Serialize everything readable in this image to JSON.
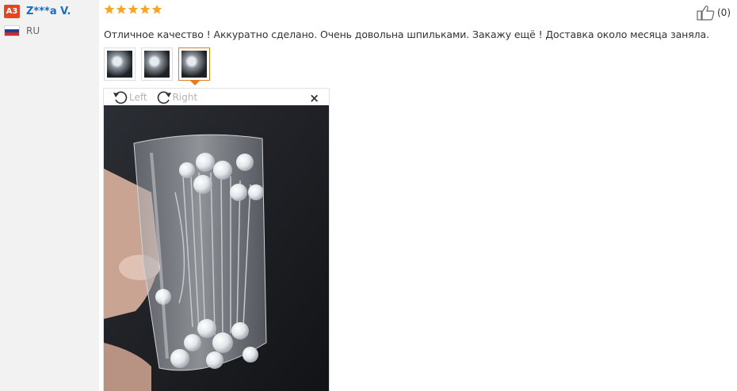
{
  "reviewer": {
    "avatar_initials": "A3",
    "name": "Z***a V.",
    "country_code": "RU",
    "flag_colors": [
      "#ffffff",
      "#1c3f9e",
      "#d52b1e"
    ]
  },
  "rating": {
    "stars": 5,
    "max": 5,
    "color": "#f5a623"
  },
  "helpful": {
    "icon": "thumbs-up-icon",
    "count_label": "(0)"
  },
  "review_text": "Отличное качество ! Аккуратно сделано. Очень довольна шпильками. Закажу ещё ! Доставка около месяца заняла.",
  "thumbnails": [
    {
      "icon": "photo-thumbnail",
      "active": false
    },
    {
      "icon": "photo-thumbnail",
      "active": false
    },
    {
      "icon": "photo-thumbnail",
      "active": true
    }
  ],
  "viewer": {
    "rotate_left_label": "Left",
    "rotate_right_label": "Right",
    "close_label": "×"
  },
  "colors": {
    "accent": "#e97b1f",
    "link": "#1a6ec0",
    "sidebar_bg": "#f2f2f2"
  }
}
